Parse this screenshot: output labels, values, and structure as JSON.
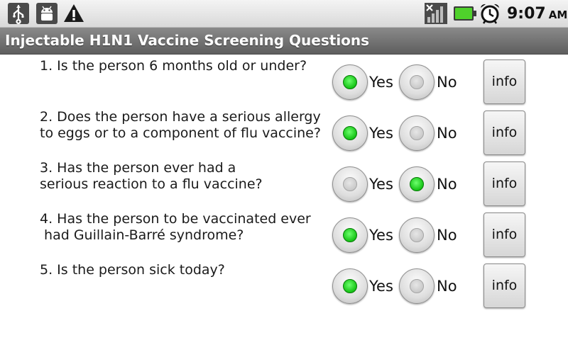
{
  "status_bar": {
    "icons": [
      "usb-icon",
      "android-debug-icon",
      "warning-icon",
      "signal-icon",
      "battery-icon",
      "alarm-icon"
    ],
    "time": "9:07",
    "ampm": "AM"
  },
  "app": {
    "title": "Injectable H1N1 Vaccine Screening Questions"
  },
  "colors": {
    "title_bar": "#707070",
    "radio_checked": "#15c315",
    "battery": "#4fd12b"
  },
  "questions": [
    {
      "text": "1. Is the person 6 months old or under?",
      "yes_label": "Yes",
      "no_label": "No",
      "selected": "Yes",
      "info_label": "info"
    },
    {
      "text": "2. Does the person have a serious allergy\nto eggs or to a component of flu vaccine?",
      "yes_label": "Yes",
      "no_label": "No",
      "selected": "Yes",
      "info_label": "info"
    },
    {
      "text": "3. Has the person ever had a\nserious reaction to a flu vaccine?",
      "yes_label": "Yes",
      "no_label": "No",
      "selected": "No",
      "info_label": "info"
    },
    {
      "text": "4. Has the person to be vaccinated ever\n had Guillain-Barré syndrome?",
      "yes_label": "Yes",
      "no_label": "No",
      "selected": "Yes",
      "info_label": "info"
    },
    {
      "text": "5. Is the person sick today?",
      "yes_label": "Yes",
      "no_label": "No",
      "selected": "Yes",
      "info_label": "info"
    }
  ]
}
